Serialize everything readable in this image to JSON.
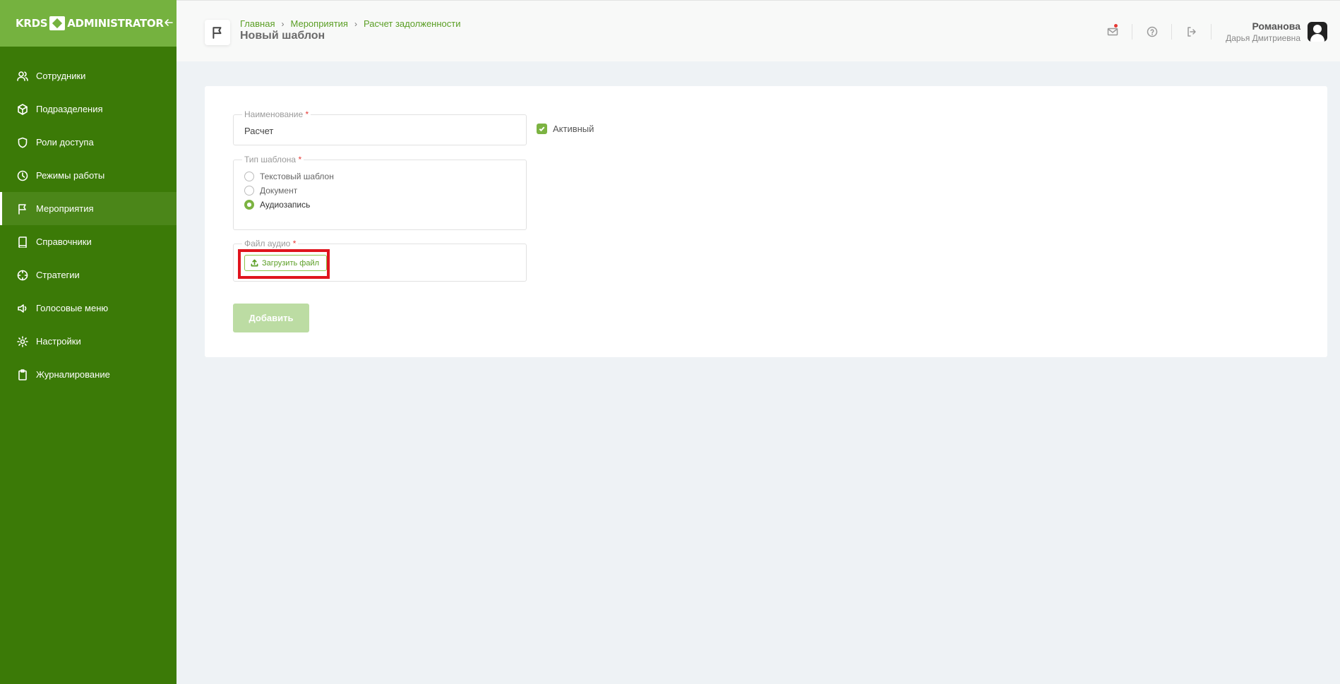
{
  "app": {
    "logo_left": "KRDS",
    "logo_right": "ADMINISTRATOR"
  },
  "sidebar": {
    "items": [
      {
        "label": "Сотрудники",
        "icon": "users-icon"
      },
      {
        "label": "Подразделения",
        "icon": "cube-icon"
      },
      {
        "label": "Роли доступа",
        "icon": "shield-icon"
      },
      {
        "label": "Режимы работы",
        "icon": "clock-icon"
      },
      {
        "label": "Мероприятия",
        "icon": "flag-icon",
        "active": true
      },
      {
        "label": "Справочники",
        "icon": "book-icon"
      },
      {
        "label": "Стратегии",
        "icon": "crosshair-icon"
      },
      {
        "label": "Голосовые меню",
        "icon": "speaker-icon"
      },
      {
        "label": "Настройки",
        "icon": "gear-icon"
      },
      {
        "label": "Журналирование",
        "icon": "clipboard-icon"
      }
    ]
  },
  "header": {
    "breadcrumb": [
      "Главная",
      "Мероприятия",
      "Расчет задолженности"
    ],
    "title": "Новый шаблон",
    "user": {
      "last_name": "Романова",
      "first_name": "Дарья Дмитриевна"
    }
  },
  "form": {
    "name": {
      "label": "Наименование",
      "required_mark": "*",
      "value": "Расчет"
    },
    "active": {
      "label": "Активный",
      "checked": true
    },
    "template_type": {
      "label": "Тип шаблона",
      "required_mark": "*",
      "options": [
        "Текстовый шаблон",
        "Документ",
        "Аудиозапись"
      ],
      "selected": "Аудиозапись"
    },
    "audio": {
      "label": "Файл аудио",
      "required_mark": "*",
      "upload_label": "Загрузить файл"
    },
    "submit_label": "Добавить"
  },
  "colors": {
    "sidebar_bg": "#3b7a07",
    "sidebar_header_bg": "#75b23f",
    "accent": "#7cb342",
    "link": "#5a9e24",
    "highlight": "#e0141e",
    "submit_disabled": "#bcdca3"
  }
}
